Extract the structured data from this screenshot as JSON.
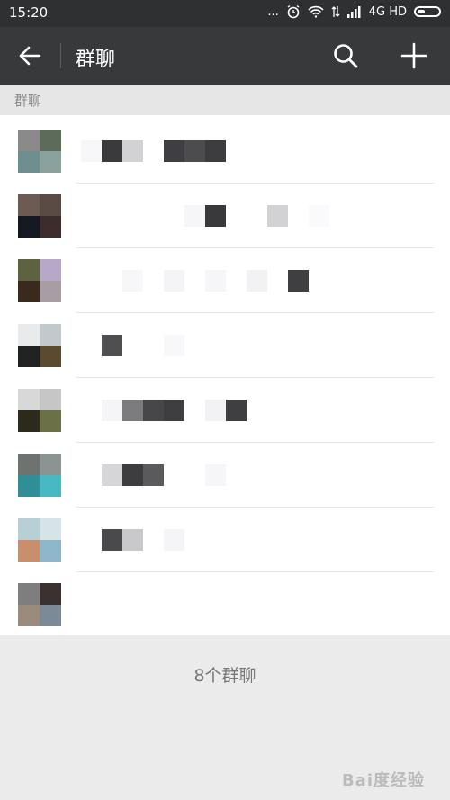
{
  "status_bar": {
    "time": "15:20",
    "network": "4G HD",
    "dots": "...",
    "alarm_icon": "alarm-icon",
    "wifi_icon": "wifi-icon",
    "signal_icon": "signal-icon",
    "battery_icon": "battery-icon"
  },
  "header": {
    "title": "群聊",
    "back_icon": "arrow-left-icon",
    "search_icon": "search-icon",
    "add_icon": "plus-icon"
  },
  "section": {
    "label": "群聊"
  },
  "group_list": [
    {
      "avatar": [
        "#8a8a8a",
        "#5d6b5a",
        "#6e8d8f",
        "#8aa19c"
      ],
      "name": [
        "#f7f6f8",
        "#3a3a3c",
        "#d2d1d3",
        "#ffffff",
        "#3f3e42",
        "#4c4b4e",
        "#3c3b3e"
      ]
    },
    {
      "avatar": [
        "#6d5a52",
        "#5a4a44",
        "#141820",
        "#3a2d2c"
      ],
      "name": [
        "#ffffff",
        "#ffffff",
        "#ffffff",
        "#ffffff",
        "#ffffff",
        "#f6f5f7",
        "#39393b",
        "#ffffff",
        "#ffffff",
        "#d2d1d3",
        "#ffffff",
        "#faf9fb"
      ]
    },
    {
      "avatar": [
        "#5d6340",
        "#b6a9c8",
        "#3a2a1e",
        "#a79da3"
      ],
      "name": [
        "#ffffff",
        "#ffffff",
        "#f7f6f8",
        "#ffffff",
        "#f4f3f5",
        "#ffffff",
        "#f6f5f7",
        "#ffffff",
        "#f2f1f3",
        "#ffffff",
        "#3f3e41"
      ]
    },
    {
      "avatar": [
        "#e8eaec",
        "#c2c9cc",
        "#202222",
        "#5a4a30"
      ],
      "name": [
        "#ffffff",
        "#4e4d50",
        "#ffffff",
        "#ffffff",
        "#f8f7f9"
      ]
    },
    {
      "avatar": [
        "#d8d8d8",
        "#c6c6c6",
        "#2c2a1a",
        "#6b7046"
      ],
      "name": [
        "#ffffff",
        "#f5f4f6",
        "#7b7a7d",
        "#474649",
        "#3e3d40",
        "#ffffff",
        "#f2f1f3",
        "#3f3e41"
      ]
    },
    {
      "avatar": [
        "#6e7370",
        "#8b9493",
        "#2f8e96",
        "#48b8c2"
      ],
      "name": [
        "#ffffff",
        "#d6d5d7",
        "#3d3c3f",
        "#5a595c",
        "#ffffff",
        "#ffffff",
        "#f6f5f7"
      ]
    },
    {
      "avatar": [
        "#b8cfd6",
        "#d6e4e8",
        "#c98e6b",
        "#8fb7cc"
      ],
      "name": [
        "#ffffff",
        "#4a494c",
        "#c9c8ca",
        "#ffffff",
        "#f5f4f6"
      ]
    },
    {
      "avatar": [
        "#7e7e7e",
        "#3a3030",
        "#9a8a7c",
        "#7c8a98"
      ],
      "name": []
    }
  ],
  "footer": {
    "count_label": "8个群聊"
  },
  "watermark": {
    "text": "Bai度经验"
  }
}
